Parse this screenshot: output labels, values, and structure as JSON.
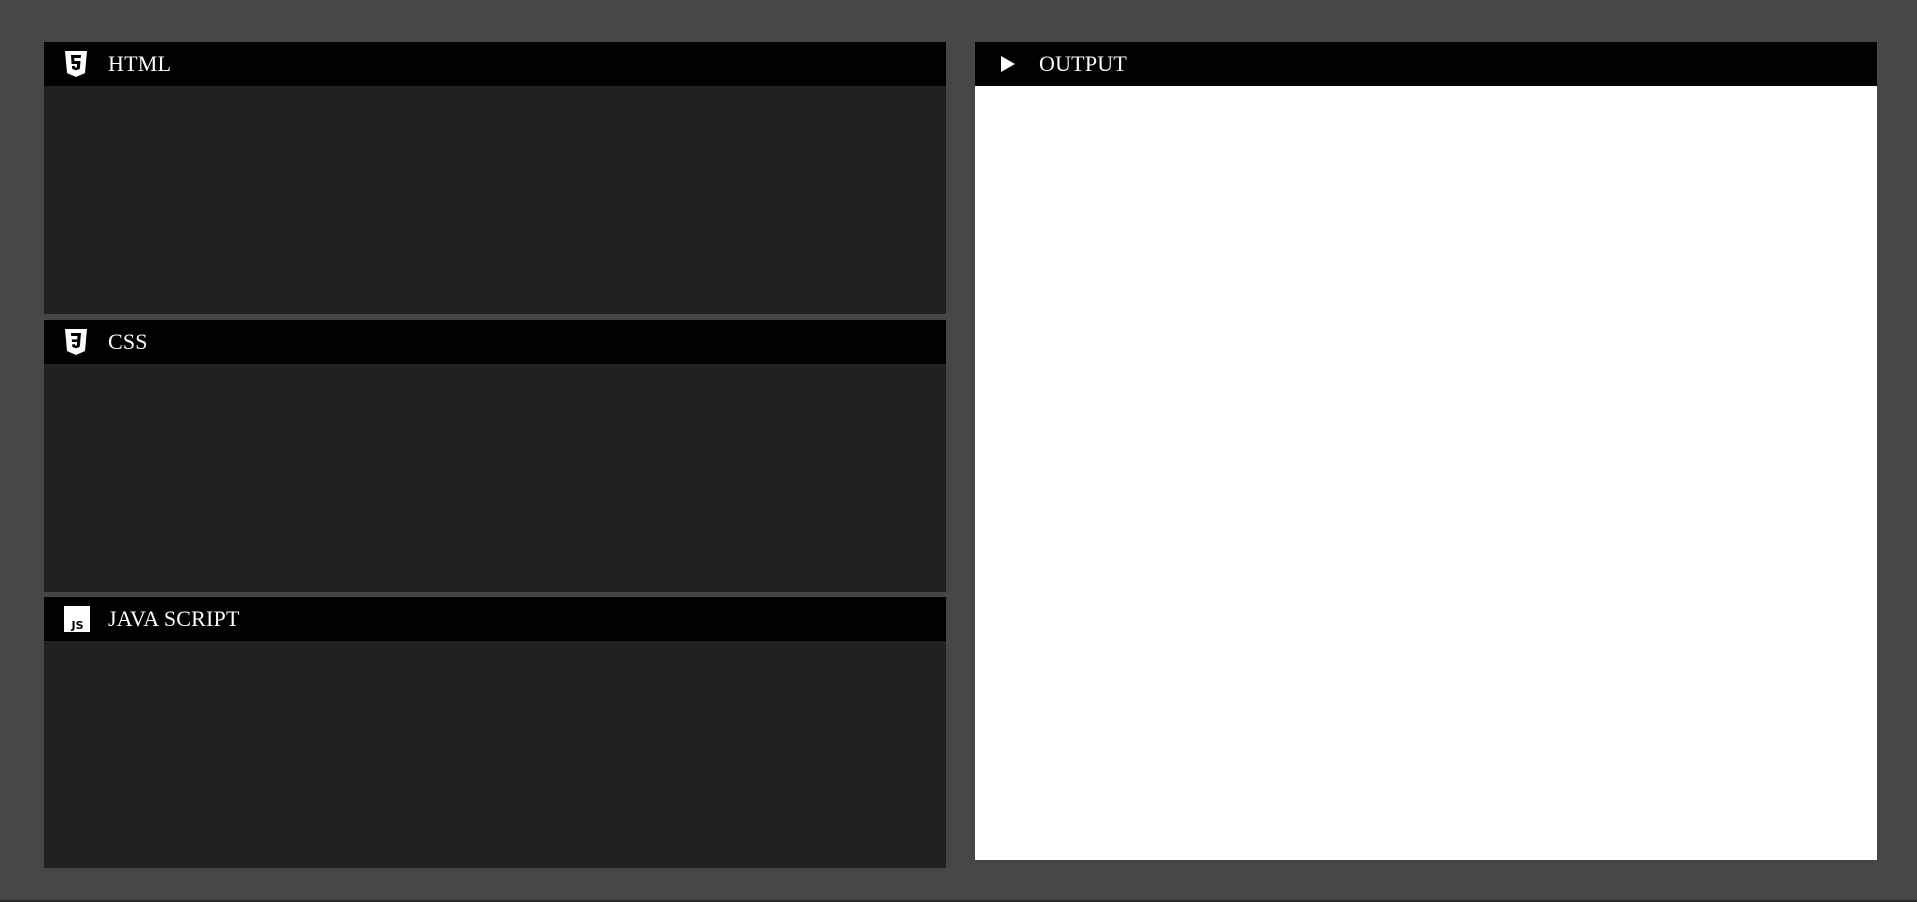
{
  "panes": {
    "html": {
      "title": "HTML",
      "icon": "html5-icon"
    },
    "css": {
      "title": "CSS",
      "icon": "css3-icon"
    },
    "js": {
      "title": "JAVA SCRIPT",
      "icon": "js-icon"
    },
    "output": {
      "title": "OUTPUT",
      "icon": "play-icon"
    }
  },
  "colors": {
    "background": "#464646",
    "header": "#000000",
    "editor": "#212121",
    "output": "#ffffff",
    "text": "#ffffff"
  }
}
